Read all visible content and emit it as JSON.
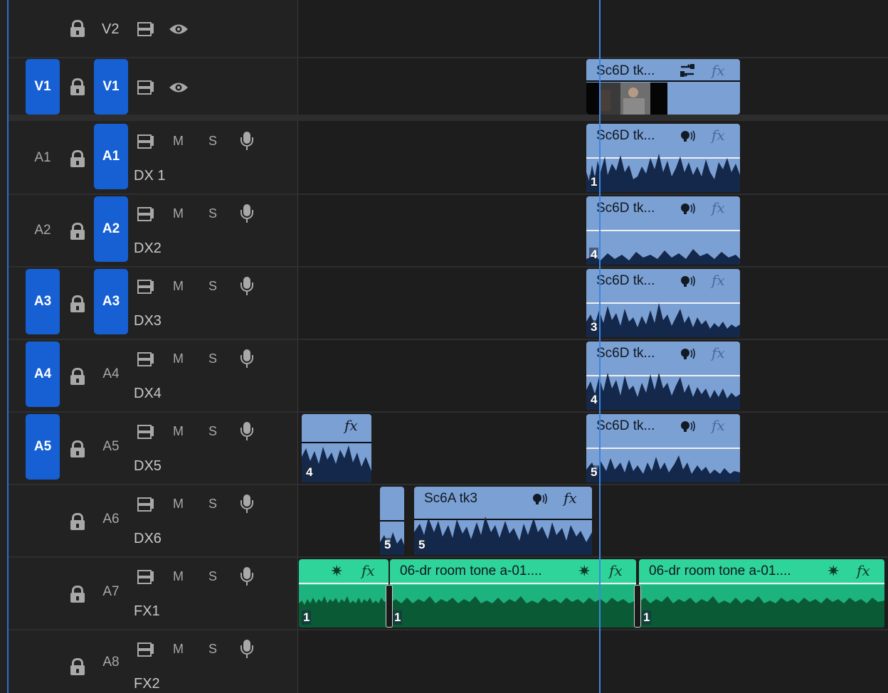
{
  "tracks": {
    "video": [
      {
        "id": "V2",
        "source": "",
        "target": "V2",
        "source_on": false,
        "target_on": false,
        "name": ""
      },
      {
        "id": "V1",
        "source": "V1",
        "target": "V1",
        "source_on": true,
        "target_on": true,
        "name": ""
      }
    ],
    "audio": [
      {
        "id": "A1",
        "source": "A1",
        "target": "A1",
        "source_on": false,
        "target_on": true,
        "name": "DX 1"
      },
      {
        "id": "A2",
        "source": "A2",
        "target": "A2",
        "source_on": false,
        "target_on": true,
        "name": "DX2"
      },
      {
        "id": "A3",
        "source": "A3",
        "target": "A3",
        "source_on": true,
        "target_on": true,
        "name": "DX3"
      },
      {
        "id": "A4",
        "source": "A4",
        "target": "A4",
        "source_on": true,
        "target_on": false,
        "name": "DX4"
      },
      {
        "id": "A5",
        "source": "A5",
        "target": "A5",
        "source_on": true,
        "target_on": false,
        "name": "DX5"
      },
      {
        "id": "A6",
        "source": "",
        "target": "A6",
        "source_on": false,
        "target_on": false,
        "name": "DX6"
      },
      {
        "id": "A7",
        "source": "",
        "target": "A7",
        "source_on": false,
        "target_on": false,
        "name": "FX1"
      },
      {
        "id": "A8",
        "source": "",
        "target": "A8",
        "source_on": false,
        "target_on": false,
        "name": "FX2"
      }
    ]
  },
  "labels": {
    "mute": "M",
    "solo": "S",
    "fx": "fx"
  },
  "clips": {
    "v1_clip": "Sc6D tk...",
    "a1_clip": "Sc6D tk...",
    "a2_clip": "Sc6D tk...",
    "a3_clip": "Sc6D tk...",
    "a4_clip": "Sc6D tk...",
    "a5_clip": "Sc6D tk...",
    "a6_clip": "Sc6A tk3",
    "a7_clip2": "06-dr room tone a-01....",
    "a7_clip3": "06-dr room tone a-01...."
  },
  "channels": {
    "a1": "1",
    "a2": "4",
    "a3": "3",
    "a4": "4",
    "a5": "5",
    "a5_left": "4",
    "a6_small": "5",
    "a6": "5",
    "a7_1": "1",
    "a7_2": "1",
    "a7_3": "1"
  },
  "colors": {
    "accent": "#1660d4",
    "audio_clip": "#7ba0d4",
    "fx_clip": "#2fd49a",
    "playhead": "#3d86e0"
  }
}
